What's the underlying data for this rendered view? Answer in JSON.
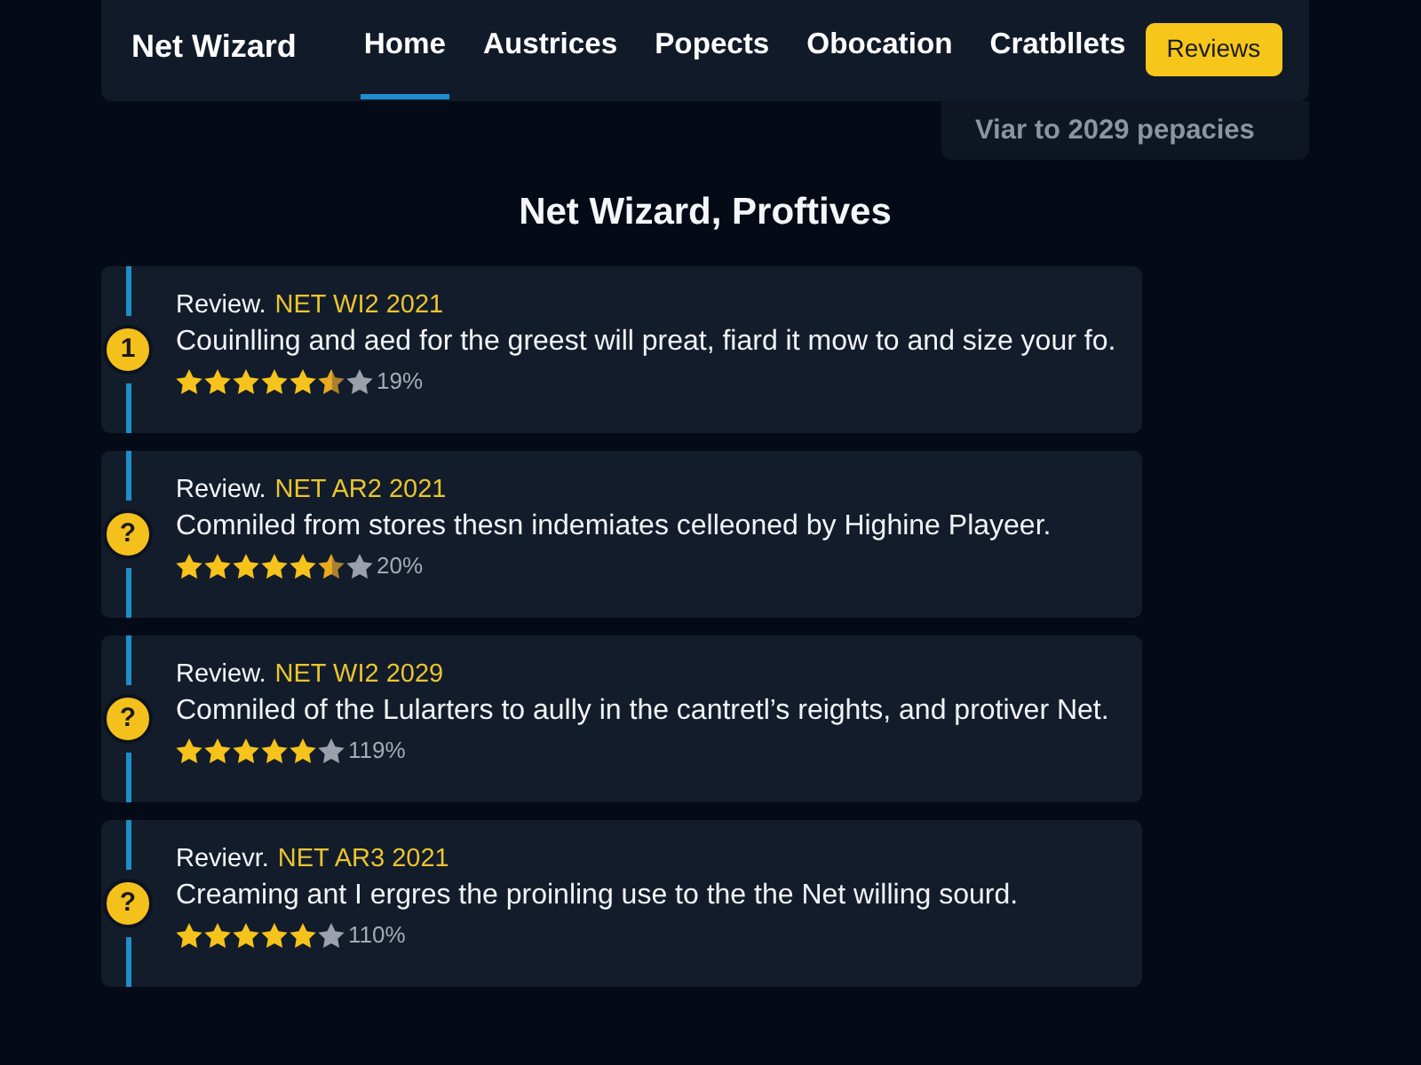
{
  "nav": {
    "brand": "Net Wizard",
    "tabs": [
      {
        "label": "Home",
        "kind": "link",
        "selected": true
      },
      {
        "label": "Austrices",
        "kind": "link",
        "selected": false
      },
      {
        "label": "Popects",
        "kind": "link",
        "selected": false
      },
      {
        "label": "Obocation",
        "kind": "link",
        "selected": false
      },
      {
        "label": "Cratbllets",
        "kind": "link",
        "selected": false
      },
      {
        "label": "Reviews",
        "kind": "button",
        "selected": false
      }
    ]
  },
  "dropdown": {
    "items": [
      {
        "label": "Viar to 2029 pepacies"
      }
    ]
  },
  "heading": "Net Wizard, Proftives",
  "reviews": [
    {
      "badge": "1",
      "label": "Review.",
      "code": "NET WI2 2021",
      "text": "Couinlling and aed for the greest will preat, fiard it mow to and size your fo.",
      "stars": 5.5,
      "percent": "19%"
    },
    {
      "badge": "?",
      "label": "Review.",
      "code": "NET AR2 2021",
      "text": "Comniled from stores thesn indemiates celleoned by Highine Playeer.",
      "stars": 5.5,
      "percent": "20%"
    },
    {
      "badge": "?",
      "label": "Review.",
      "code": "NET WI2 2029",
      "text": "Comniled of the Lularters to aully in the cantretl’s reights, and protiver Net.",
      "stars": 5,
      "percent": "119%"
    },
    {
      "badge": "?",
      "label": "Revievr.",
      "code": "NET AR3 2021",
      "text": "Creaming ant I ergres the proinling use to the the Net willing sourd.",
      "stars": 5,
      "percent": "110%"
    }
  ]
}
